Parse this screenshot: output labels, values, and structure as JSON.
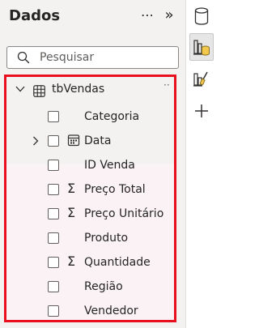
{
  "panel": {
    "title": "Dados",
    "more_label": "⋯",
    "collapse_label": "»"
  },
  "search": {
    "placeholder": "Pesquisar",
    "value": ""
  },
  "table": {
    "name": "tbVendas",
    "more_label": "··",
    "fields": [
      {
        "label": "Categoria",
        "icon": "none",
        "expandable": false
      },
      {
        "label": "Data",
        "icon": "calendar-icon",
        "expandable": true
      },
      {
        "label": "ID Venda",
        "icon": "none",
        "expandable": false
      },
      {
        "label": "Preço Total",
        "icon": "sigma-icon",
        "expandable": false
      },
      {
        "label": "Preço Unitário",
        "icon": "sigma-icon",
        "expandable": false
      },
      {
        "label": "Produto",
        "icon": "none",
        "expandable": false
      },
      {
        "label": "Quantidade",
        "icon": "sigma-icon",
        "expandable": false
      },
      {
        "label": "Região",
        "icon": "none",
        "expandable": false
      },
      {
        "label": "Vendedor",
        "icon": "none",
        "expandable": false
      }
    ]
  },
  "rail": {
    "items": [
      {
        "name": "data-icon",
        "active": false
      },
      {
        "name": "build-visual-icon",
        "active": true
      },
      {
        "name": "format-brush-icon",
        "active": false
      },
      {
        "name": "add-icon",
        "active": false
      }
    ]
  },
  "colors": {
    "highlight_border": "#e8101e",
    "panel_bg": "#f3f2f1"
  }
}
